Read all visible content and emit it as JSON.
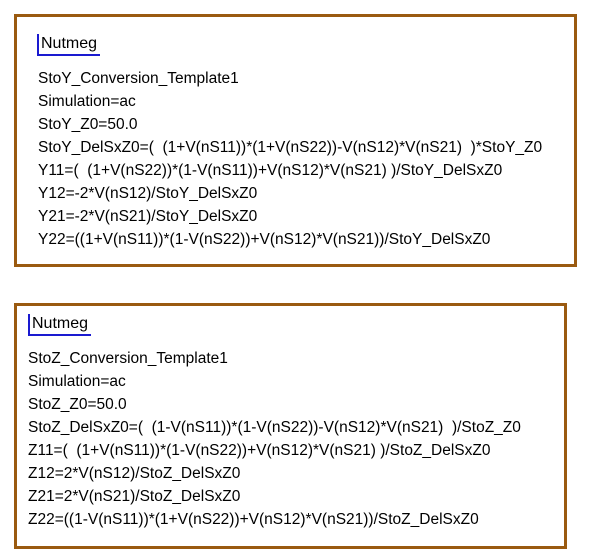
{
  "blocks": [
    {
      "tag": "Nutmeg",
      "lines": [
        "StoY_Conversion_Template1",
        "Simulation=ac",
        "StoY_Z0=50.0",
        "StoY_DelSxZ0=(  (1+V(nS11))*(1+V(nS22))-V(nS12)*V(nS21)  )*StoY_Z0",
        "Y11=(  (1+V(nS22))*(1-V(nS11))+V(nS12)*V(nS21) )/StoY_DelSxZ0",
        "Y12=-2*V(nS12)/StoY_DelSxZ0",
        "Y21=-2*V(nS21)/StoY_DelSxZ0",
        "Y22=((1+V(nS11))*(1-V(nS22))+V(nS12)*V(nS21))/StoY_DelSxZ0"
      ]
    },
    {
      "tag": "Nutmeg",
      "lines": [
        "StoZ_Conversion_Template1",
        "Simulation=ac",
        "StoZ_Z0=50.0",
        "StoZ_DelSxZ0=(  (1-V(nS11))*(1-V(nS22))-V(nS12)*V(nS21)  )/StoZ_Z0",
        "Z11=(  (1+V(nS11))*(1-V(nS22))+V(nS12)*V(nS21) )/StoZ_DelSxZ0",
        "Z12=2*V(nS12)/StoZ_DelSxZ0",
        "Z21=2*V(nS21)/StoZ_DelSxZ0",
        "Z22=((1-V(nS11))*(1+V(nS22))+V(nS12)*V(nS21))/StoZ_DelSxZ0"
      ]
    }
  ],
  "colors": {
    "frame": "#9a5a10",
    "tag_marker": "#1a1ad0"
  }
}
